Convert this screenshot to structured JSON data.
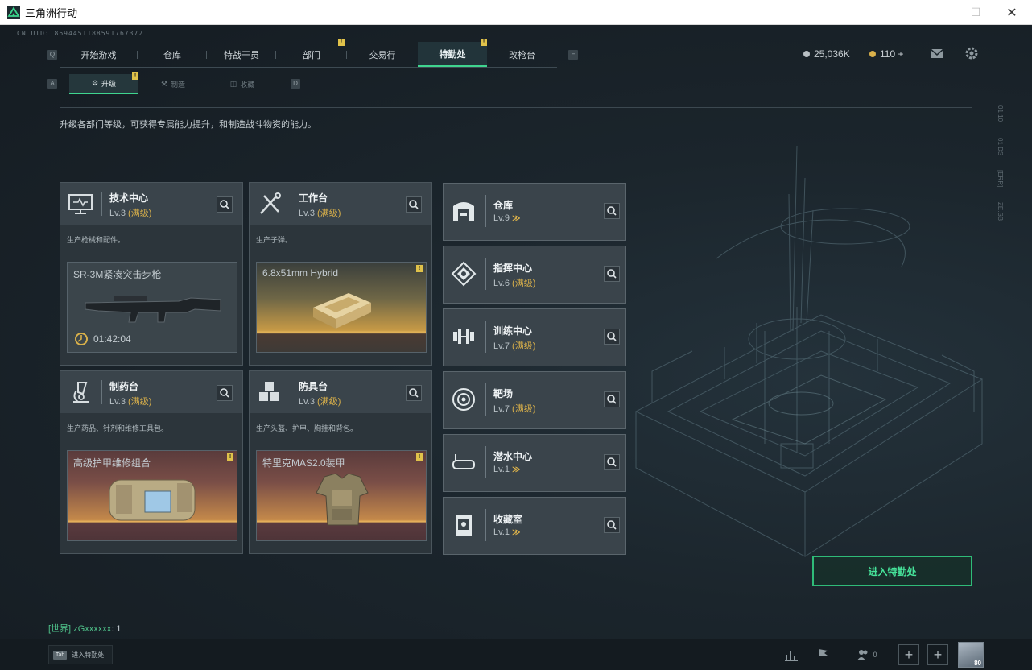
{
  "window": {
    "title": "三角洲行动",
    "min_icon": "minimize-icon",
    "max_icon": "maximize-icon",
    "close_icon": "close-icon"
  },
  "uid": "CN UID:18694451188591767372",
  "top_nav": {
    "left_key": "Q",
    "right_key": "E",
    "tabs": [
      "开始游戏",
      "仓库",
      "特战干员",
      "部门",
      "交易行",
      "特勤处",
      "改枪台"
    ],
    "active": "特勤处",
    "alert_tabs": [
      "部门",
      "特勤处"
    ]
  },
  "currency": {
    "coins": "25,036K",
    "points": "110 +"
  },
  "top_icons": [
    "mail-icon",
    "gear-icon"
  ],
  "sub_nav": {
    "left_key": "A",
    "right_key": "D",
    "tabs": [
      "升级",
      "制造",
      "收藏"
    ],
    "active": "升级"
  },
  "description": "升级各部门等级，可获得专属能力提升，和制造战斗物资的能力。",
  "facilities": [
    {
      "name": "技术中心",
      "level": "Lv.3",
      "status": "(满级)",
      "desc": "生产枪械和配件。",
      "item": "SR-3M紧凑突击步枪",
      "timer": "01:42:04",
      "icon": "monitor-icon"
    },
    {
      "name": "工作台",
      "level": "Lv.3",
      "status": "(满级)",
      "desc": "生产子弹。",
      "item": "6.8x51mm Hybrid",
      "icon": "tools-icon"
    },
    {
      "name": "制药台",
      "level": "Lv.3",
      "status": "(满级)",
      "desc": "生产药品、针剂和维修工具包。",
      "item": "高级护甲维修组合",
      "icon": "microscope-icon"
    },
    {
      "name": "防具台",
      "level": "Lv.3",
      "status": "(满级)",
      "desc": "生产头盔、护甲、胸挂和背包。",
      "item": "特里克MAS2.0装甲",
      "icon": "cubes-icon"
    }
  ],
  "side_facilities": [
    {
      "name": "仓库",
      "level": "Lv.9",
      "status": "",
      "upgradable": true,
      "icon": "warehouse-icon"
    },
    {
      "name": "指挥中心",
      "level": "Lv.6",
      "status": "(满级)",
      "upgradable": false,
      "icon": "command-icon"
    },
    {
      "name": "训练中心",
      "level": "Lv.7",
      "status": "(满级)",
      "upgradable": false,
      "icon": "dumbbell-icon"
    },
    {
      "name": "靶场",
      "level": "Lv.7",
      "status": "(满级)",
      "upgradable": false,
      "icon": "target-icon"
    },
    {
      "name": "潜水中心",
      "level": "Lv.1",
      "status": "",
      "upgradable": true,
      "icon": "diving-mask-icon"
    },
    {
      "name": "收藏室",
      "level": "Lv.1",
      "status": "",
      "upgradable": true,
      "icon": "collection-icon"
    }
  ],
  "up_arrow": "≫",
  "enter_button": "进入特勤处",
  "chat": {
    "channel": "[世界]",
    "user": "zGxxxxxx",
    "message": ": 1"
  },
  "bottom": {
    "tab_key": "Tab",
    "tab_label": "进入特勤处",
    "friends_count": "0",
    "avatar_level": "80"
  },
  "side_codes": [
    "01 10",
    "01 DS",
    "[ERR]",
    "ZE.SB"
  ]
}
